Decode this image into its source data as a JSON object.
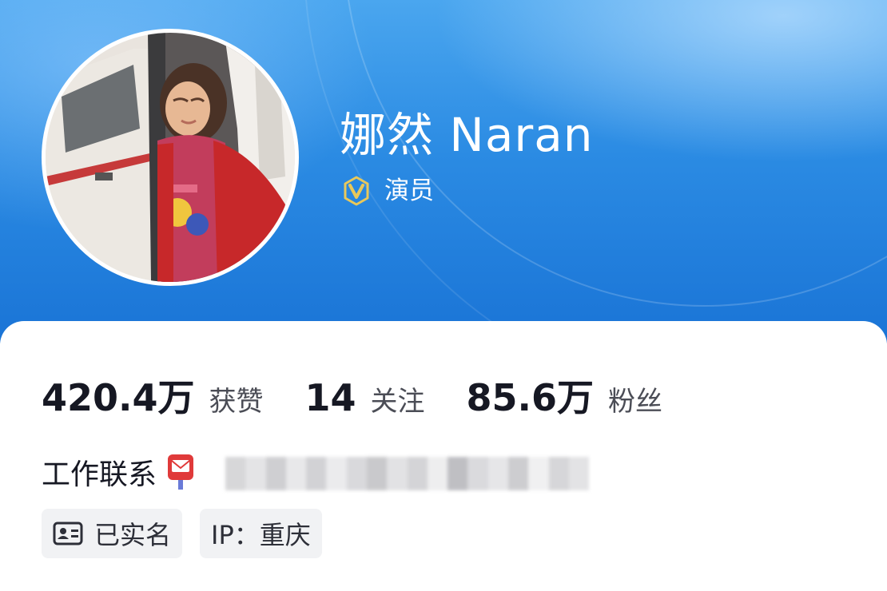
{
  "profile": {
    "name": "娜然 Naran",
    "verified_title": "演员",
    "verify_badge_letter": "V"
  },
  "stats": [
    {
      "value": "420.4万",
      "label": "获赞"
    },
    {
      "value": "14",
      "label": "关注"
    },
    {
      "value": "85.6万",
      "label": "粉丝"
    }
  ],
  "contact": {
    "label": "工作联系",
    "icon": "mailbox-icon",
    "value_redacted": true
  },
  "tags": {
    "real_name": "已实名",
    "ip_location": "IP：重庆"
  },
  "icons": {
    "verify": "verified-v-icon",
    "real_name": "id-card-icon"
  },
  "colors": {
    "header_top": "#4aa6ef",
    "header_bottom": "#1a74d6",
    "badge_gold": "#e8c85a",
    "text_primary": "#161823",
    "chip_bg": "#f1f2f4"
  }
}
